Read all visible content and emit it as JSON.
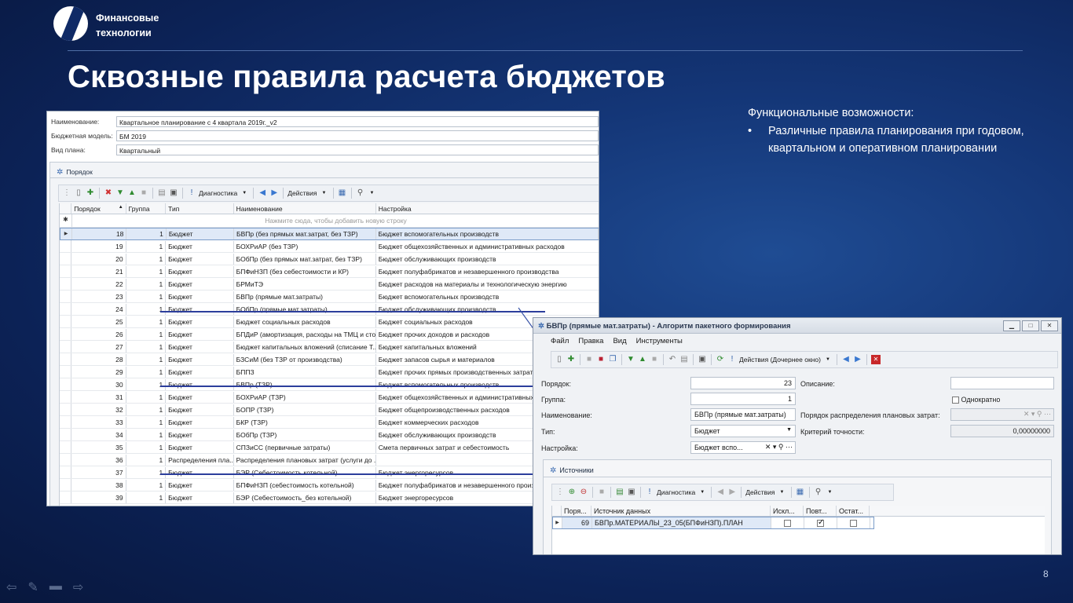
{
  "brand": {
    "line1": "Финансовые",
    "line2": "технологии"
  },
  "slide": {
    "title": "Сквозные правила расчета бюджетов",
    "features_heading": "Функциональные возможности:",
    "features": [
      "Различные правила планирования при годовом, квартальном и оперативном планировании"
    ],
    "page_number": "8"
  },
  "form": {
    "fields": [
      {
        "label": "Наименование:",
        "value": "Квартальное планирование с 4 квартала 2019г._v2"
      },
      {
        "label": "Бюджетная модель:",
        "value": "БМ 2019"
      },
      {
        "label": "Вид плана:",
        "value": "Квартальный"
      }
    ]
  },
  "order_panel": {
    "title": "Порядок",
    "toolbar": {
      "diagnostics": "Диагностика",
      "actions": "Действия"
    },
    "columns": [
      "Порядок",
      "Группа",
      "Тип",
      "Наименование",
      "Настройка"
    ],
    "add_row_hint": "Нажмите сюда, чтобы добавить новую строку",
    "rows": [
      {
        "order": "18",
        "group": "1",
        "type": "Бюджет",
        "name": "БВПр (без прямых мат.затрат, без ТЗР)",
        "setting": "Бюджет вспомогательных производств"
      },
      {
        "order": "19",
        "group": "1",
        "type": "Бюджет",
        "name": "БОХРиАР (без ТЗР)",
        "setting": "Бюджет общехозяйственных и административных расходов"
      },
      {
        "order": "20",
        "group": "1",
        "type": "Бюджет",
        "name": "БОбПр (без прямых мат.затрат, без ТЗР)",
        "setting": "Бюджет обслуживающих производств"
      },
      {
        "order": "21",
        "group": "1",
        "type": "Бюджет",
        "name": "БПФиНЗП (без себестоимости и КР)",
        "setting": "Бюджет полуфабрикатов и незавершенного производства"
      },
      {
        "order": "22",
        "group": "1",
        "type": "Бюджет",
        "name": "БРМиТЭ",
        "setting": "Бюджет расходов на материалы и технологическую энергию"
      },
      {
        "order": "23",
        "group": "1",
        "type": "Бюджет",
        "name": "БВПр (прямые мат.затраты)",
        "setting": "Бюджет вспомогательных производств"
      },
      {
        "order": "24",
        "group": "1",
        "type": "Бюджет",
        "name": "БОбПр (прямые мат.затраты)",
        "setting": "Бюджет обслуживающих производств"
      },
      {
        "order": "25",
        "group": "1",
        "type": "Бюджет",
        "name": "Бюджет социальных расходов",
        "setting": "Бюджет социальных расходов"
      },
      {
        "order": "26",
        "group": "1",
        "type": "Бюджет",
        "name": "БПДиР (амортизация, расходы на ТМЦ и стор...",
        "setting": "Бюджет прочих доходов и расходов"
      },
      {
        "order": "27",
        "group": "1",
        "type": "Бюджет",
        "name": "Бюджет капитальных вложений (списание Т...",
        "setting": "Бюджет капитальных вложений"
      },
      {
        "order": "28",
        "group": "1",
        "type": "Бюджет",
        "name": "БЗСиМ (без ТЗР от производства)",
        "setting": "Бюджет запасов сырья и материалов"
      },
      {
        "order": "29",
        "group": "1",
        "type": "Бюджет",
        "name": "БППЗ",
        "setting": "Бюджет прочих прямых производственных затрат"
      },
      {
        "order": "30",
        "group": "1",
        "type": "Бюджет",
        "name": "БВПр (ТЗР)",
        "setting": "Бюджет вспомогательных производств"
      },
      {
        "order": "31",
        "group": "1",
        "type": "Бюджет",
        "name": "БОХРиАР (ТЗР)",
        "setting": "Бюджет общехозяйственных и административных расходов"
      },
      {
        "order": "32",
        "group": "1",
        "type": "Бюджет",
        "name": "БОПР (ТЗР)",
        "setting": "Бюджет общепроизводственных расходов"
      },
      {
        "order": "33",
        "group": "1",
        "type": "Бюджет",
        "name": "БКР (ТЗР)",
        "setting": "Бюджет коммерческих расходов"
      },
      {
        "order": "34",
        "group": "1",
        "type": "Бюджет",
        "name": "БОбПр (ТЗР)",
        "setting": "Бюджет обслуживающих производств"
      },
      {
        "order": "35",
        "group": "1",
        "type": "Бюджет",
        "name": "СПЗиСС (первичные затраты)",
        "setting": "Смета первичных затрат и себестоимость"
      },
      {
        "order": "36",
        "group": "1",
        "type": "Распределения пла...",
        "name": "Распределения плановых затрат (услуги до ...",
        "setting": ""
      },
      {
        "order": "37",
        "group": "1",
        "type": "Бюджет",
        "name": "БЭР (Себестоимость котельной)",
        "setting": "Бюджет энергоресурсов"
      },
      {
        "order": "38",
        "group": "1",
        "type": "Бюджет",
        "name": "БПФиНЗП (себестоимость котельной)",
        "setting": "Бюджет полуфабрикатов и незавершенного производства"
      },
      {
        "order": "39",
        "group": "1",
        "type": "Бюджет",
        "name": "БЭР (Себестоимость_без котельной)",
        "setting": "Бюджет энергоресурсов"
      }
    ]
  },
  "dialog": {
    "title": "БВПр (прямые мат.затраты) - Алгоритм пакетного формирования",
    "menu": [
      "Файл",
      "Правка",
      "Вид",
      "Инструменты"
    ],
    "toolbar": {
      "actions": "Действия (Дочернее окно)"
    },
    "order_label": "Порядок:",
    "order_value": "23",
    "group_label": "Группа:",
    "group_value": "1",
    "name_label": "Наименование:",
    "name_value": "БВПр (прямые мат.затраты)",
    "type_label": "Тип:",
    "type_value": "Бюджет",
    "setting_label": "Настройка:",
    "setting_value": "Бюджет вспо...",
    "description_label": "Описание:",
    "once_label": "Однократно",
    "distribution_label": "Порядок распределения плановых затрат:",
    "accuracy_label": "Критерий точности:",
    "accuracy_value": "0,00000000",
    "sources": {
      "title": "Источники",
      "toolbar": {
        "diagnostics": "Диагностика",
        "actions": "Действия"
      },
      "columns": [
        "Поря...",
        "Источник данных",
        "Искл...",
        "Повт...",
        "Остат..."
      ],
      "rows": [
        {
          "order": "69",
          "source": "БВПр.МАТЕРИАЛЫ_23_05(БПФиНЗП).ПЛАН",
          "exclude": false,
          "repeat": true,
          "remainder": false
        }
      ]
    }
  }
}
